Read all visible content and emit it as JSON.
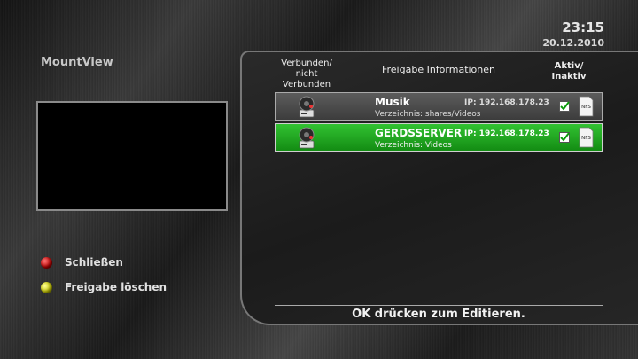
{
  "clock": {
    "time": "23:15",
    "date": "20.12.2010"
  },
  "screen": {
    "title": "MountView"
  },
  "keys": [
    {
      "color": "#cc0000",
      "label": "Schließen"
    },
    {
      "color": "#d4d400",
      "label": "Freigabe löschen"
    }
  ],
  "columns": {
    "connected": "Verbunden/\nnicht\nVerbunden",
    "info": "Freigabe Informationen",
    "active": "Aktiv/\nInaktiv"
  },
  "mounts": [
    {
      "name": "Musik",
      "ip": "IP: 192.168.178.23",
      "directory": "Verzeichnis: shares/Videos",
      "type": "NFS",
      "active": true,
      "selected": false
    },
    {
      "name": "GERDSSERVER",
      "ip": "IP: 192.168.178.23",
      "directory": "Verzeichnis: Videos",
      "type": "NFS",
      "active": true,
      "selected": true
    }
  ],
  "hint": "OK drücken zum Editieren.",
  "colors": {
    "selected_row": "#1fa01f",
    "normal_row": "#4a4a4a"
  }
}
